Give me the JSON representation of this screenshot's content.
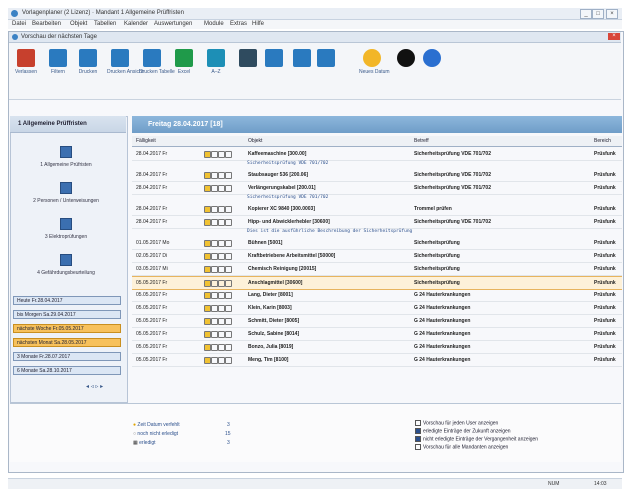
{
  "window": {
    "title": "Vorlagenplaner (2 Lizenz) · Mandant 1 Allgemeine Prüffristen",
    "controls": [
      "_",
      "□",
      "×"
    ]
  },
  "menu": [
    "Datei",
    "Bearbeiten",
    "Objekt",
    "Tabellen",
    "Kalender",
    "Auswertungen",
    "Module",
    "Extras",
    "Hilfe"
  ],
  "inner_window": {
    "title": "Vorschau der nächsten Tage",
    "close": "×"
  },
  "toolbar": [
    {
      "label": "Verlassen",
      "icon": "exit-icon",
      "color": "#c7402d"
    },
    {
      "label": "Filtern",
      "icon": "filter-icon",
      "color": "#2a7abf"
    },
    {
      "label": "Drucken",
      "icon": "printer-icon",
      "color": "#2a7abf"
    },
    {
      "label": "Drucken Ansicht",
      "icon": "printer-icon",
      "color": "#2a7abf"
    },
    {
      "label": "Drucken Tabelle",
      "icon": "printer-icon",
      "color": "#2a7abf"
    },
    {
      "label": "Excel",
      "icon": "excel-icon",
      "color": "#1f9a4a"
    },
    {
      "label": "A–Z",
      "icon": "sort-icon",
      "color": "#1d8fb6"
    },
    {
      "label": "",
      "icon": "list-icon",
      "color": "#2f4b5f"
    },
    {
      "label": "",
      "icon": "day-view-icon",
      "color": "#2a7abf"
    },
    {
      "label": "",
      "icon": "week-view-icon",
      "color": "#2a7abf"
    },
    {
      "label": "",
      "icon": "month-view-icon",
      "color": "#2a7abf"
    },
    {
      "label": "Neues Datum",
      "icon": "sun-icon",
      "color": "#f2b628"
    },
    {
      "label": "",
      "icon": "camera-icon",
      "color": "#111111"
    },
    {
      "label": "",
      "icon": "help-icon",
      "color": "#2a6fd0"
    }
  ],
  "left": {
    "header": "1 Allgemeine Prüffristen",
    "categories": [
      "1 Allgemeine Prüfristen",
      "2 Personen / Unterweisungen",
      "3 Elektroprüfungen",
      "4 Gefährdungsbeurteilung"
    ],
    "buttons": [
      {
        "label": "Heute Fr.28.04.2017",
        "highlight": false
      },
      {
        "label": "bis Morgen Sa.29.04.2017",
        "highlight": false
      },
      {
        "label": "nächste Woche Fr.05.05.2017",
        "highlight": true
      },
      {
        "label": "nächsten Monat Sa.28.05.2017",
        "highlight": true
      },
      {
        "label": "3 Monate Fr.28.07.2017",
        "highlight": false
      },
      {
        "label": "6 Monate Sa.28.10.2017",
        "highlight": false
      }
    ]
  },
  "grid": {
    "heading": "Freitag 28.04.2017 [18]",
    "columns": [
      "Fälligkeit",
      "Objekt",
      "Betreff",
      "Bereich"
    ],
    "rows": [
      {
        "date": "28.04.2017 Fr",
        "name": "Kaffeemaschine [300.00]",
        "subject": "Sicherheitsprüfung VDE 701/702",
        "area": "Prüsfunk"
      },
      {
        "date": "28.04.2017 Fr",
        "name": "Staubsauger 536 [200.06]",
        "subject": "Sicherheitsprüfung VDE 701/702",
        "area": "Prüsfunk"
      },
      {
        "date": "28.04.2017 Fr",
        "name": "Verlängerungskabel [200.01]",
        "subject": "Sicherheitsprüfung VDE 701/702",
        "area": "Prüsfunk"
      },
      {
        "date": "28.04.2017 Fr",
        "name": "Kopierer XC 9840 [300.0003]",
        "subject": "Trommel prüfen",
        "area": "Prüsfunk"
      },
      {
        "date": "28.04.2017 Fr",
        "name": "Hipp- und Abwicklerhebler [30600]",
        "subject": "Sicherheitsprüfung VDE 701/702",
        "area": "Prüsfunk"
      },
      {
        "date": "01.05.2017 Mo",
        "name": "Bühnen [5001]",
        "subject": "Sicherheitsprüfung",
        "area": "Prüsfunk"
      },
      {
        "date": "02.05.2017 Di",
        "name": "Kraftbetriebene Arbeitsmittel [50000]",
        "subject": "Sicherheitsprüfung",
        "area": "Prüsfunk"
      },
      {
        "date": "03.05.2017 Mi",
        "name": "Chemisch Reinigung [20015]",
        "subject": "Sicherheitsprüfung",
        "area": "Prüsfunk"
      },
      {
        "date": "05.05.2017 Fr",
        "name": "Anschlagmittel [30600]",
        "subject": "Sicherheitsprüfung",
        "area": "Prüsfunk",
        "selected": true
      },
      {
        "date": "05.05.2017 Fr",
        "name": "Lang, Dieter [8001]",
        "subject": "G 24 Hauterkrankungen",
        "area": "Prüsfunk"
      },
      {
        "date": "05.05.2017 Fr",
        "name": "Klein, Karin [8003]",
        "subject": "G 24 Hauterkrankungen",
        "area": "Prüsfunk"
      },
      {
        "date": "05.05.2017 Fr",
        "name": "Schmitt, Dieter [8005]",
        "subject": "G 24 Hauterkrankungen",
        "area": "Prüsfunk"
      },
      {
        "date": "05.05.2017 Fr",
        "name": "Schulz, Sabine [8014]",
        "subject": "G 24 Hauterkrankungen",
        "area": "Prüsfunk"
      },
      {
        "date": "05.05.2017 Fr",
        "name": "Bonzo, Julia [8019]",
        "subject": "G 24 Hauterkrankungen",
        "area": "Prüsfunk"
      },
      {
        "date": "05.05.2017 Fr",
        "name": "Meng, Tim [8100]",
        "subject": "G 24 Hauterkrankungen",
        "area": "Prüsfunk"
      }
    ],
    "notes": [
      {
        "after": 0,
        "text": "Sicherheitsprüfung VDE 701/702"
      },
      {
        "after": 2,
        "text": "Sicherheitsprüfung VDE 701/702"
      },
      {
        "after": 4,
        "text": "Dies ist die ausführliche Beschreibung der Sicherheitsprüfung"
      }
    ]
  },
  "legend": [
    {
      "label": "Zeit Datum verfehlt",
      "count": "3",
      "icon": "bulb-icon"
    },
    {
      "label": "noch nicht erledigt",
      "count": "15",
      "icon": "clock-icon"
    },
    {
      "label": "erledigt",
      "count": "3",
      "icon": "calendar-icon"
    }
  ],
  "options": [
    {
      "label": "Vorschau für jeden User anzeigen",
      "checked": false
    },
    {
      "label": "erledigte Einträge der Zukunft anzeigen",
      "checked": true
    },
    {
      "label": "nicht erledigte Einträge der Vergangenheit anzeigen",
      "checked": true
    },
    {
      "label": "Vorschau für alle Mandanten anzeigen",
      "checked": false
    }
  ],
  "status": {
    "mode": "NUM",
    "time": "14:03"
  }
}
